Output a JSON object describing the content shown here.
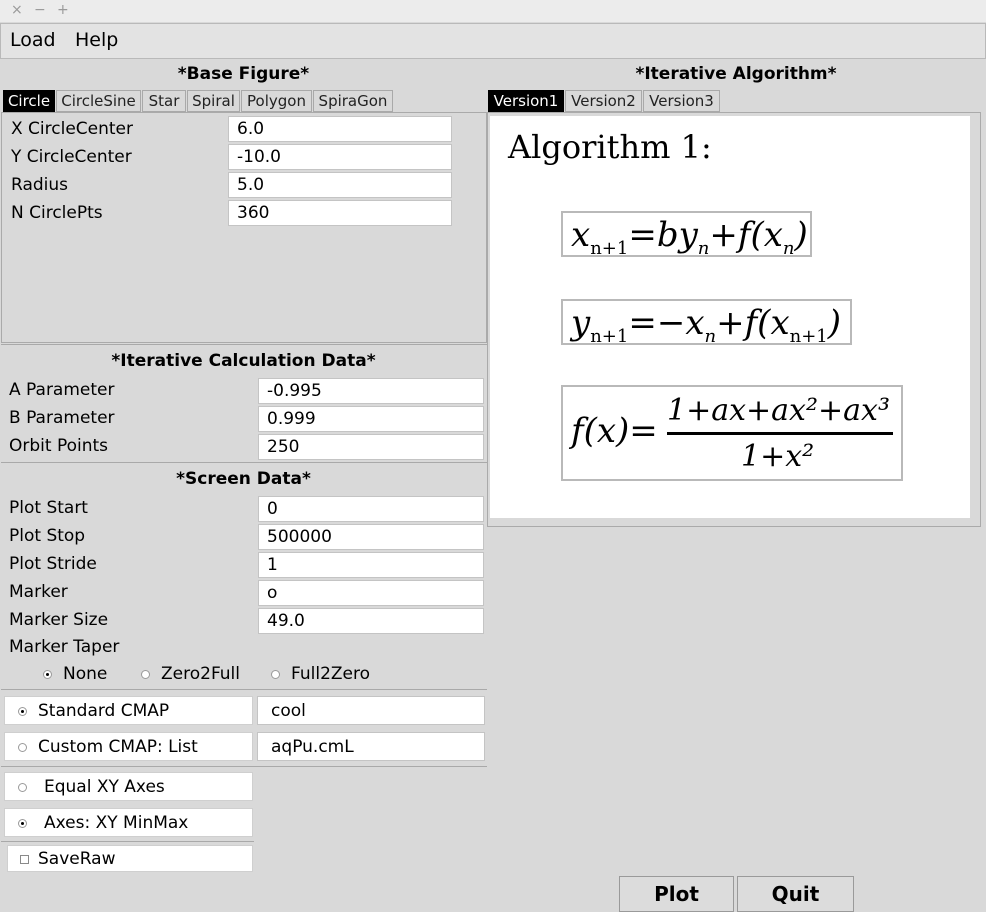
{
  "window": {
    "controls": [
      "×",
      "−",
      "+"
    ]
  },
  "menu": {
    "load": "Load",
    "help": "Help"
  },
  "base_figure": {
    "title": "*Base Figure*",
    "tabs": [
      "Circle",
      "CircleSine",
      "Star",
      "Spiral",
      "Polygon",
      "SpiraGon"
    ],
    "active_tab": "Circle",
    "fields": [
      {
        "label": "X CircleCenter",
        "value": "6.0"
      },
      {
        "label": "Y CircleCenter",
        "value": "-10.0"
      },
      {
        "label": "Radius",
        "value": "5.0"
      },
      {
        "label": "N CirclePts",
        "value": "360"
      }
    ]
  },
  "iterative_algorithm": {
    "title": "*Iterative Algorithm*",
    "tabs": [
      "Version1",
      "Version2",
      "Version3"
    ],
    "active_tab": "Version1",
    "heading": "Algorithm 1:",
    "eq1": {
      "lhs": "x",
      "lhs_sub": "n+1",
      "rhs": "=by",
      "rhs_sub": "n",
      "rhs2": "+f(x",
      "rhs2_sub": "n",
      "rhs2_end": ")"
    },
    "eq2": {
      "lhs": "y",
      "lhs_sub": "n+1",
      "rhs": "=−x",
      "rhs_sub": "n",
      "rhs2": "+f(x",
      "rhs2_sub": "n+1",
      "rhs2_end": ")"
    },
    "eq3": {
      "lhs": "f(x)=",
      "num": "1+ax+ax²+ax³",
      "den": "1+x²"
    }
  },
  "calc_data": {
    "title": "*Iterative Calculation Data*",
    "fields": [
      {
        "label": "A Parameter",
        "value": "-0.995"
      },
      {
        "label": "B Parameter",
        "value": "0.999"
      },
      {
        "label": "Orbit Points",
        "value": "250"
      }
    ]
  },
  "screen_data": {
    "title": "*Screen Data*",
    "fields": [
      {
        "label": "Plot Start",
        "value": "0"
      },
      {
        "label": "Plot Stop",
        "value": "500000"
      },
      {
        "label": "Plot Stride",
        "value": "1"
      },
      {
        "label": "Marker",
        "value": "o"
      },
      {
        "label": "Marker Size",
        "value": "49.0"
      }
    ],
    "taper_label": "Marker Taper",
    "taper_options": [
      "None",
      "Zero2Full",
      "Full2Zero"
    ],
    "taper_selected": "None"
  },
  "cmap": {
    "standard_label": "Standard CMAP",
    "standard_value": "cool",
    "custom_label": "Custom CMAP: List",
    "custom_value": "aqPu.cmL",
    "selected": "standard"
  },
  "axes": {
    "equal_label": "Equal XY Axes",
    "minmax_label": "Axes: XY MinMax",
    "selected": "minmax"
  },
  "saveraw": {
    "label": "SaveRaw",
    "checked": false
  },
  "buttons": {
    "plot": "Plot",
    "quit": "Quit"
  }
}
